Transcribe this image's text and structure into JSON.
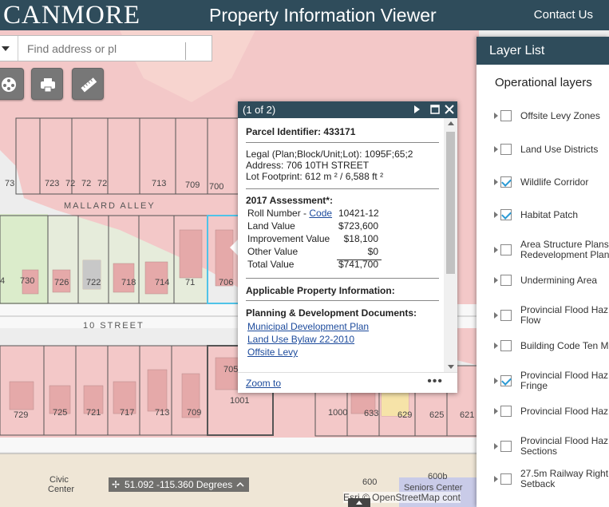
{
  "header": {
    "brand": "CANMORE",
    "title": "Property Information Viewer",
    "contact": "Contact Us"
  },
  "search": {
    "placeholder": "Find address or pl"
  },
  "map": {
    "street_labels": [
      "MALLARD ALLEY",
      "10 STREET"
    ],
    "lot_numbers_upper": [
      "73",
      "723",
      "72",
      "72",
      "72",
      "713",
      "709",
      "700"
    ],
    "lot_numbers_middle": [
      "4",
      "730",
      "726",
      "722",
      "718",
      "714",
      "71",
      "706"
    ],
    "lot_numbers_lower": [
      "729",
      "725",
      "721",
      "717",
      "713",
      "709",
      "705",
      "1001",
      "1000",
      "633",
      "629",
      "625",
      "621"
    ],
    "place_labels": [
      "Civic",
      "Center",
      "Seniors Center",
      "600b",
      "600"
    ],
    "colors": {
      "zone_pink": "#f3c8c8",
      "zone_green": "#d9ecc6",
      "selected_outline": "#4fc3e8"
    }
  },
  "popup": {
    "count": "(1 of 2)",
    "parcel_label": "Parcel Identifier: 433171",
    "legal": "Legal (Plan;Block/Unit;Lot): 1095F;65;2",
    "address": "Address: 706 10TH STREET",
    "footprint": "Lot Footprint: 612 m ² / 6,588 ft ²",
    "assessment_title": "2017 Assessment*:",
    "roll_label": "Roll Number -",
    "roll_code_link": "Code",
    "roll_value": "10421-12",
    "rows": [
      {
        "label": "Land Value",
        "value": "$723,600"
      },
      {
        "label": "Improvement Value",
        "value": "$18,100"
      },
      {
        "label": "Other Value",
        "value": "$0"
      },
      {
        "label": "Total Value",
        "value": "$741,700"
      }
    ],
    "applicable": "Applicable Property Information:",
    "planning_title": "Planning & Development Documents:",
    "links": [
      "Municipal Development Plan",
      "Land Use Bylaw 22-2010",
      "Offsite Levy"
    ],
    "zoom_to": "Zoom to",
    "more": "•••"
  },
  "layer_list": {
    "title": "Layer List",
    "subtitle": "Operational layers",
    "layers": [
      {
        "label": "Offsite Levy Zones",
        "checked": false
      },
      {
        "label": "Land Use Districts",
        "checked": false
      },
      {
        "label": "Wildlife Corridor",
        "checked": true
      },
      {
        "label": "Habitat Patch",
        "checked": true
      },
      {
        "label": "Area Structure Plans",
        "label2": "Redevelopment Plan",
        "checked": false
      },
      {
        "label": "Undermining Area",
        "checked": false
      },
      {
        "label": "Provincial Flood Haz",
        "label2": "Flow",
        "checked": false
      },
      {
        "label": "Building Code Ten M",
        "checked": false
      },
      {
        "label": "Provincial Flood Haz",
        "label2": "Fringe",
        "checked": true
      },
      {
        "label": "Provincial Flood Haz",
        "checked": false
      },
      {
        "label": "Provincial Flood Haz",
        "label2": "Sections",
        "checked": false
      },
      {
        "label": "27.5m Railway Right",
        "label2": "Setback",
        "checked": false
      }
    ]
  },
  "coordinates": "51.092 -115.360 Degrees",
  "attribution": "Esri © OpenStreetMap cont"
}
